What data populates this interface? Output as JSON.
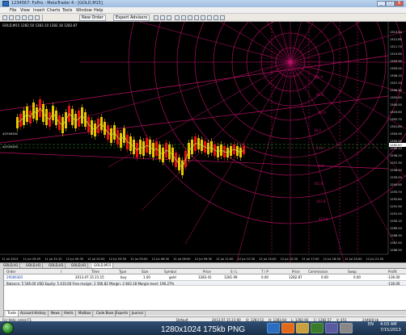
{
  "window": {
    "title": "1234567: FxPro - MetaTrader 4 - [GOLD,M15]",
    "controls": [
      "_",
      "□",
      "X"
    ]
  },
  "menu": [
    "File",
    "View",
    "Insert",
    "Charts",
    "Tools",
    "Window",
    "Help"
  ],
  "toolbar": {
    "new_order": "New Order",
    "expert_advisors": "Expert Advisors"
  },
  "chart": {
    "title": "GOLD,M15  1282.50 1283.10 1282.18 1282.87",
    "price_labels": [
      "1313.50",
      "1312.60",
      "1311.70",
      "1310.80",
      "1309.90",
      "1309.00",
      "1308.10",
      "1307.20",
      "1306.30",
      "1305.40",
      "1304.50",
      "1303.60",
      "1302.70",
      "1301.80",
      "1300.90",
      "1300.00",
      "1299.10",
      "1298.20",
      "1297.30",
      "1296.40",
      "1295.50",
      "1294.60",
      "1293.70",
      "1292.80",
      "1291.90",
      "1291.00",
      "1290.10",
      "1289.20",
      "1288.30",
      "1287.40",
      "1286.50"
    ],
    "current_price": "1282.87",
    "left_label_1": "#2956365",
    "left_label_2": "#2956365",
    "time_labels": [
      "11 Jul 2013",
      "11 Jul 20:45",
      "11 Jul 22:15",
      "12 Jul 00:30",
      "12 Jul 02:00",
      "12 Jul 03:30",
      "12 Jul 05:00",
      "12 Jul 06:30",
      "12 Jul 08:00",
      "12 Jul 09:30",
      "12 Jul 11:00",
      "12 Jul 12:30",
      "12 Jul 14:00",
      "12 Jul 15:30",
      "12 Jul 17:00",
      "12 Jul 18:30",
      "12 Jul 20:00",
      "12 Jul 21:30"
    ],
    "fib_levels": [
      "100.0",
      "61.8",
      "50.0",
      "38.2",
      "23.6",
      "0.0",
      "161.8",
      "261.8",
      "423.6"
    ]
  },
  "chart_tabs": [
    "GOLD,H1",
    "GOLD,H1",
    "GOLD,H1",
    "GOLD,H1",
    "GOLD,M15"
  ],
  "terminal": {
    "headers": [
      "Order",
      "/",
      "Time",
      "Type",
      "Size",
      "Symbol",
      "Price",
      "S / L",
      "T / P",
      "Price",
      "Commission",
      "Swap",
      "Profit"
    ],
    "row": {
      "order": "29566365",
      "time": "2013.07.15 21:15",
      "type": "buy",
      "size": "1.00",
      "symbol": "gold",
      "price": "1283.41",
      "sl": "1281.99",
      "tp": "0.00",
      "cur_price": "1282.87",
      "commission": "0.00",
      "swap": "0.00",
      "profit": "-136.00"
    },
    "balance": "Balance: 5 546.00 USD  Equity: 5 410.00  Free margin: 2 566.82  Margin: 2 843.18  Margin level: 190.27%",
    "balance_profit": "-136.00",
    "tabs": [
      "Trade",
      "Account History",
      "News",
      "Alerts",
      "Mailbox",
      "Code Base",
      "Experts",
      "Journal"
    ]
  },
  "status": {
    "help": "For Help, press F1",
    "profile": "Default",
    "datetime": "2013.07.15 21:00",
    "open": "O: 1283.52",
    "high": "H: 1283.64",
    "low": "L: 1282.66",
    "close": "C: 1282.57",
    "volume": "V: 451",
    "traffic": "2446/8 kb"
  },
  "taskbar": {
    "clock_time": "4:03 AM",
    "clock_date": "7/15/2013",
    "lang": "EN"
  },
  "caption": "1280x1024  175kb  PNG",
  "colors": {
    "bull": "#e8c400",
    "bear": "#e81010",
    "fib": "#c0106a",
    "ma": "#c8e84a",
    "level": "#3a9a3a"
  }
}
